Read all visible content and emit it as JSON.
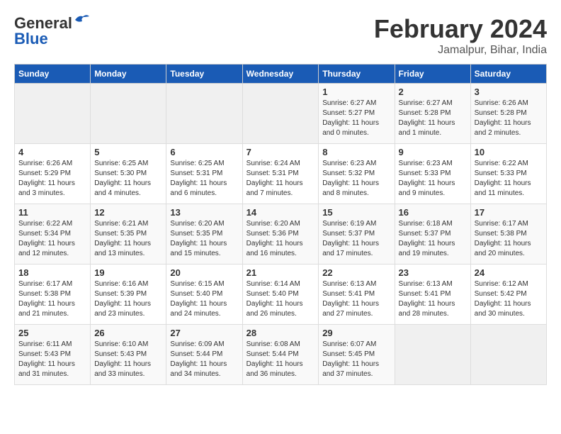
{
  "header": {
    "logo_line1": "General",
    "logo_line2": "Blue",
    "month": "February 2024",
    "location": "Jamalpur, Bihar, India"
  },
  "weekdays": [
    "Sunday",
    "Monday",
    "Tuesday",
    "Wednesday",
    "Thursday",
    "Friday",
    "Saturday"
  ],
  "weeks": [
    [
      {
        "day": "",
        "info": ""
      },
      {
        "day": "",
        "info": ""
      },
      {
        "day": "",
        "info": ""
      },
      {
        "day": "",
        "info": ""
      },
      {
        "day": "1",
        "info": "Sunrise: 6:27 AM\nSunset: 5:27 PM\nDaylight: 11 hours and 0 minutes."
      },
      {
        "day": "2",
        "info": "Sunrise: 6:27 AM\nSunset: 5:28 PM\nDaylight: 11 hours and 1 minute."
      },
      {
        "day": "3",
        "info": "Sunrise: 6:26 AM\nSunset: 5:28 PM\nDaylight: 11 hours and 2 minutes."
      }
    ],
    [
      {
        "day": "4",
        "info": "Sunrise: 6:26 AM\nSunset: 5:29 PM\nDaylight: 11 hours and 3 minutes."
      },
      {
        "day": "5",
        "info": "Sunrise: 6:25 AM\nSunset: 5:30 PM\nDaylight: 11 hours and 4 minutes."
      },
      {
        "day": "6",
        "info": "Sunrise: 6:25 AM\nSunset: 5:31 PM\nDaylight: 11 hours and 6 minutes."
      },
      {
        "day": "7",
        "info": "Sunrise: 6:24 AM\nSunset: 5:31 PM\nDaylight: 11 hours and 7 minutes."
      },
      {
        "day": "8",
        "info": "Sunrise: 6:23 AM\nSunset: 5:32 PM\nDaylight: 11 hours and 8 minutes."
      },
      {
        "day": "9",
        "info": "Sunrise: 6:23 AM\nSunset: 5:33 PM\nDaylight: 11 hours and 9 minutes."
      },
      {
        "day": "10",
        "info": "Sunrise: 6:22 AM\nSunset: 5:33 PM\nDaylight: 11 hours and 11 minutes."
      }
    ],
    [
      {
        "day": "11",
        "info": "Sunrise: 6:22 AM\nSunset: 5:34 PM\nDaylight: 11 hours and 12 minutes."
      },
      {
        "day": "12",
        "info": "Sunrise: 6:21 AM\nSunset: 5:35 PM\nDaylight: 11 hours and 13 minutes."
      },
      {
        "day": "13",
        "info": "Sunrise: 6:20 AM\nSunset: 5:35 PM\nDaylight: 11 hours and 15 minutes."
      },
      {
        "day": "14",
        "info": "Sunrise: 6:20 AM\nSunset: 5:36 PM\nDaylight: 11 hours and 16 minutes."
      },
      {
        "day": "15",
        "info": "Sunrise: 6:19 AM\nSunset: 5:37 PM\nDaylight: 11 hours and 17 minutes."
      },
      {
        "day": "16",
        "info": "Sunrise: 6:18 AM\nSunset: 5:37 PM\nDaylight: 11 hours and 19 minutes."
      },
      {
        "day": "17",
        "info": "Sunrise: 6:17 AM\nSunset: 5:38 PM\nDaylight: 11 hours and 20 minutes."
      }
    ],
    [
      {
        "day": "18",
        "info": "Sunrise: 6:17 AM\nSunset: 5:38 PM\nDaylight: 11 hours and 21 minutes."
      },
      {
        "day": "19",
        "info": "Sunrise: 6:16 AM\nSunset: 5:39 PM\nDaylight: 11 hours and 23 minutes."
      },
      {
        "day": "20",
        "info": "Sunrise: 6:15 AM\nSunset: 5:40 PM\nDaylight: 11 hours and 24 minutes."
      },
      {
        "day": "21",
        "info": "Sunrise: 6:14 AM\nSunset: 5:40 PM\nDaylight: 11 hours and 26 minutes."
      },
      {
        "day": "22",
        "info": "Sunrise: 6:13 AM\nSunset: 5:41 PM\nDaylight: 11 hours and 27 minutes."
      },
      {
        "day": "23",
        "info": "Sunrise: 6:13 AM\nSunset: 5:41 PM\nDaylight: 11 hours and 28 minutes."
      },
      {
        "day": "24",
        "info": "Sunrise: 6:12 AM\nSunset: 5:42 PM\nDaylight: 11 hours and 30 minutes."
      }
    ],
    [
      {
        "day": "25",
        "info": "Sunrise: 6:11 AM\nSunset: 5:43 PM\nDaylight: 11 hours and 31 minutes."
      },
      {
        "day": "26",
        "info": "Sunrise: 6:10 AM\nSunset: 5:43 PM\nDaylight: 11 hours and 33 minutes."
      },
      {
        "day": "27",
        "info": "Sunrise: 6:09 AM\nSunset: 5:44 PM\nDaylight: 11 hours and 34 minutes."
      },
      {
        "day": "28",
        "info": "Sunrise: 6:08 AM\nSunset: 5:44 PM\nDaylight: 11 hours and 36 minutes."
      },
      {
        "day": "29",
        "info": "Sunrise: 6:07 AM\nSunset: 5:45 PM\nDaylight: 11 hours and 37 minutes."
      },
      {
        "day": "",
        "info": ""
      },
      {
        "day": "",
        "info": ""
      }
    ]
  ]
}
